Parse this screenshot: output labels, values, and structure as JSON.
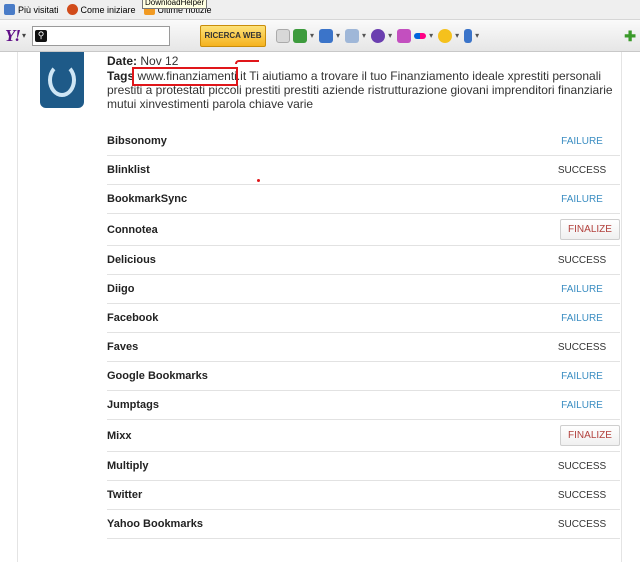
{
  "bookmarks": [
    {
      "label": "Più visitati",
      "icon": "bookmark-icon",
      "color": "#4a7cc7"
    },
    {
      "label": "Come iniziare",
      "icon": "firefox-icon",
      "color": "#d14b1a"
    },
    {
      "label": "Ultime notizie",
      "icon": "rss-icon",
      "color": "#f19a22"
    }
  ],
  "tooltip": "DownloadHelper",
  "toolbar": {
    "logo": "Y!",
    "search_value": "",
    "search_button": "RICERCA WEB"
  },
  "post": {
    "date_label": "Date:",
    "date_value": "Nov 12",
    "tags_label": "Tags",
    "tag_link": "www.finanziamenti.it",
    "tags_text": " Ti aiutiamo a trovare il tuo Finanziamento ideale xprestiti personali prestiti a protestati piccoli prestiti prestiti aziende ristrutturazione giovani imprenditori finanziarie mutui xinvestimenti parola chiave varie"
  },
  "services": [
    {
      "name": "Bibsonomy",
      "status": "FAILURE"
    },
    {
      "name": "Blinklist",
      "status": "SUCCESS"
    },
    {
      "name": "BookmarkSync",
      "status": "FAILURE"
    },
    {
      "name": "Connotea",
      "status": "FINALIZE"
    },
    {
      "name": "Delicious",
      "status": "SUCCESS"
    },
    {
      "name": "Diigo",
      "status": "FAILURE"
    },
    {
      "name": "Facebook",
      "status": "FAILURE"
    },
    {
      "name": "Faves",
      "status": "SUCCESS"
    },
    {
      "name": "Google Bookmarks",
      "status": "FAILURE"
    },
    {
      "name": "Jumptags",
      "status": "FAILURE"
    },
    {
      "name": "Mixx",
      "status": "FINALIZE"
    },
    {
      "name": "Multiply",
      "status": "SUCCESS"
    },
    {
      "name": "Twitter",
      "status": "SUCCESS"
    },
    {
      "name": "Yahoo Bookmarks",
      "status": "SUCCESS"
    }
  ],
  "colors": {
    "failure": "#3b8ec2",
    "success": "#333333",
    "finalize": "#b2403c",
    "annotation": "#e0161a"
  }
}
